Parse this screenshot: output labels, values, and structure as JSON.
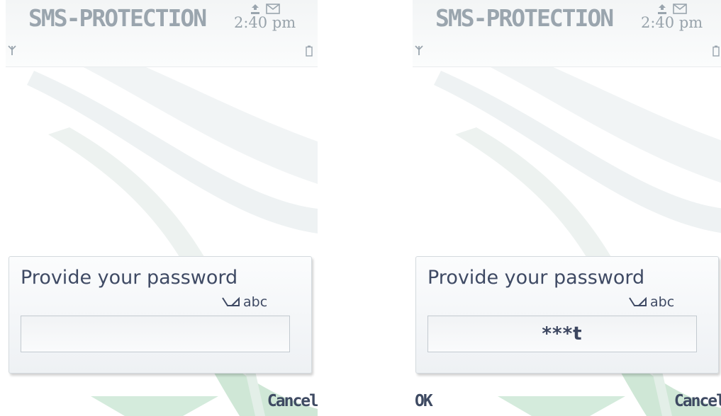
{
  "screens": [
    {
      "app_title": "SMS-PROTECTION",
      "clock": "2:40 pm",
      "prompt": "Provide your password",
      "input_mode": "abc",
      "password_value": "",
      "softkey_left": "",
      "softkey_right": "Cancel"
    },
    {
      "app_title": "SMS-PROTECTION",
      "clock": "2:40 pm",
      "prompt": "Provide your password",
      "input_mode": "abc",
      "password_value": "***t",
      "softkey_left": "OK",
      "softkey_right": "Cancel"
    }
  ],
  "icons": {
    "upload": "upload-icon",
    "message": "envelope-icon",
    "signal": "signal-antenna-icon",
    "battery": "battery-icon",
    "input_mode": "pen-input-icon"
  },
  "colors": {
    "title_text": "#9aa5ae",
    "dialog_text": "#3f4a64",
    "wallpaper_accent": "#cfe7d8"
  }
}
